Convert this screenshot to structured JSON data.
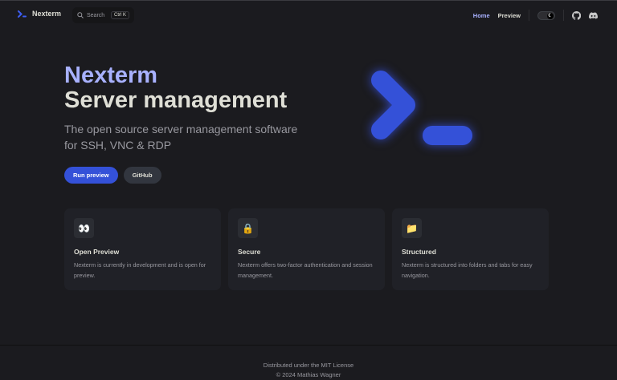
{
  "nav": {
    "brand": "Nexterm",
    "search_placeholder": "Search",
    "search_shortcut": "Ctrl K",
    "links": [
      "Home",
      "Preview"
    ],
    "active": "Home"
  },
  "hero": {
    "title": "Nexterm",
    "subtitle": "Server management",
    "tagline": "The open source server management software for SSH, VNC & RDP",
    "primary_button": "Run preview",
    "secondary_button": "GitHub"
  },
  "features": [
    {
      "icon": "eyes-icon",
      "glyph": "👀",
      "title": "Open Preview",
      "description": "Nexterm is currently in development and is open for preview."
    },
    {
      "icon": "lock-icon",
      "glyph": "🔒",
      "title": "Secure",
      "description": "Nexterm offers two-factor authentication and session management."
    },
    {
      "icon": "folder-icon",
      "glyph": "📁",
      "title": "Structured",
      "description": "Nexterm is structured into folders and tabs for easy navigation."
    }
  ],
  "footer": {
    "license": "Distributed under the MIT License",
    "copyright": "© 2024 Mathias Wagner"
  },
  "colors": {
    "accent": "#3451d8",
    "brand_text": "#a8b1ff",
    "background": "#1b1b1f"
  }
}
